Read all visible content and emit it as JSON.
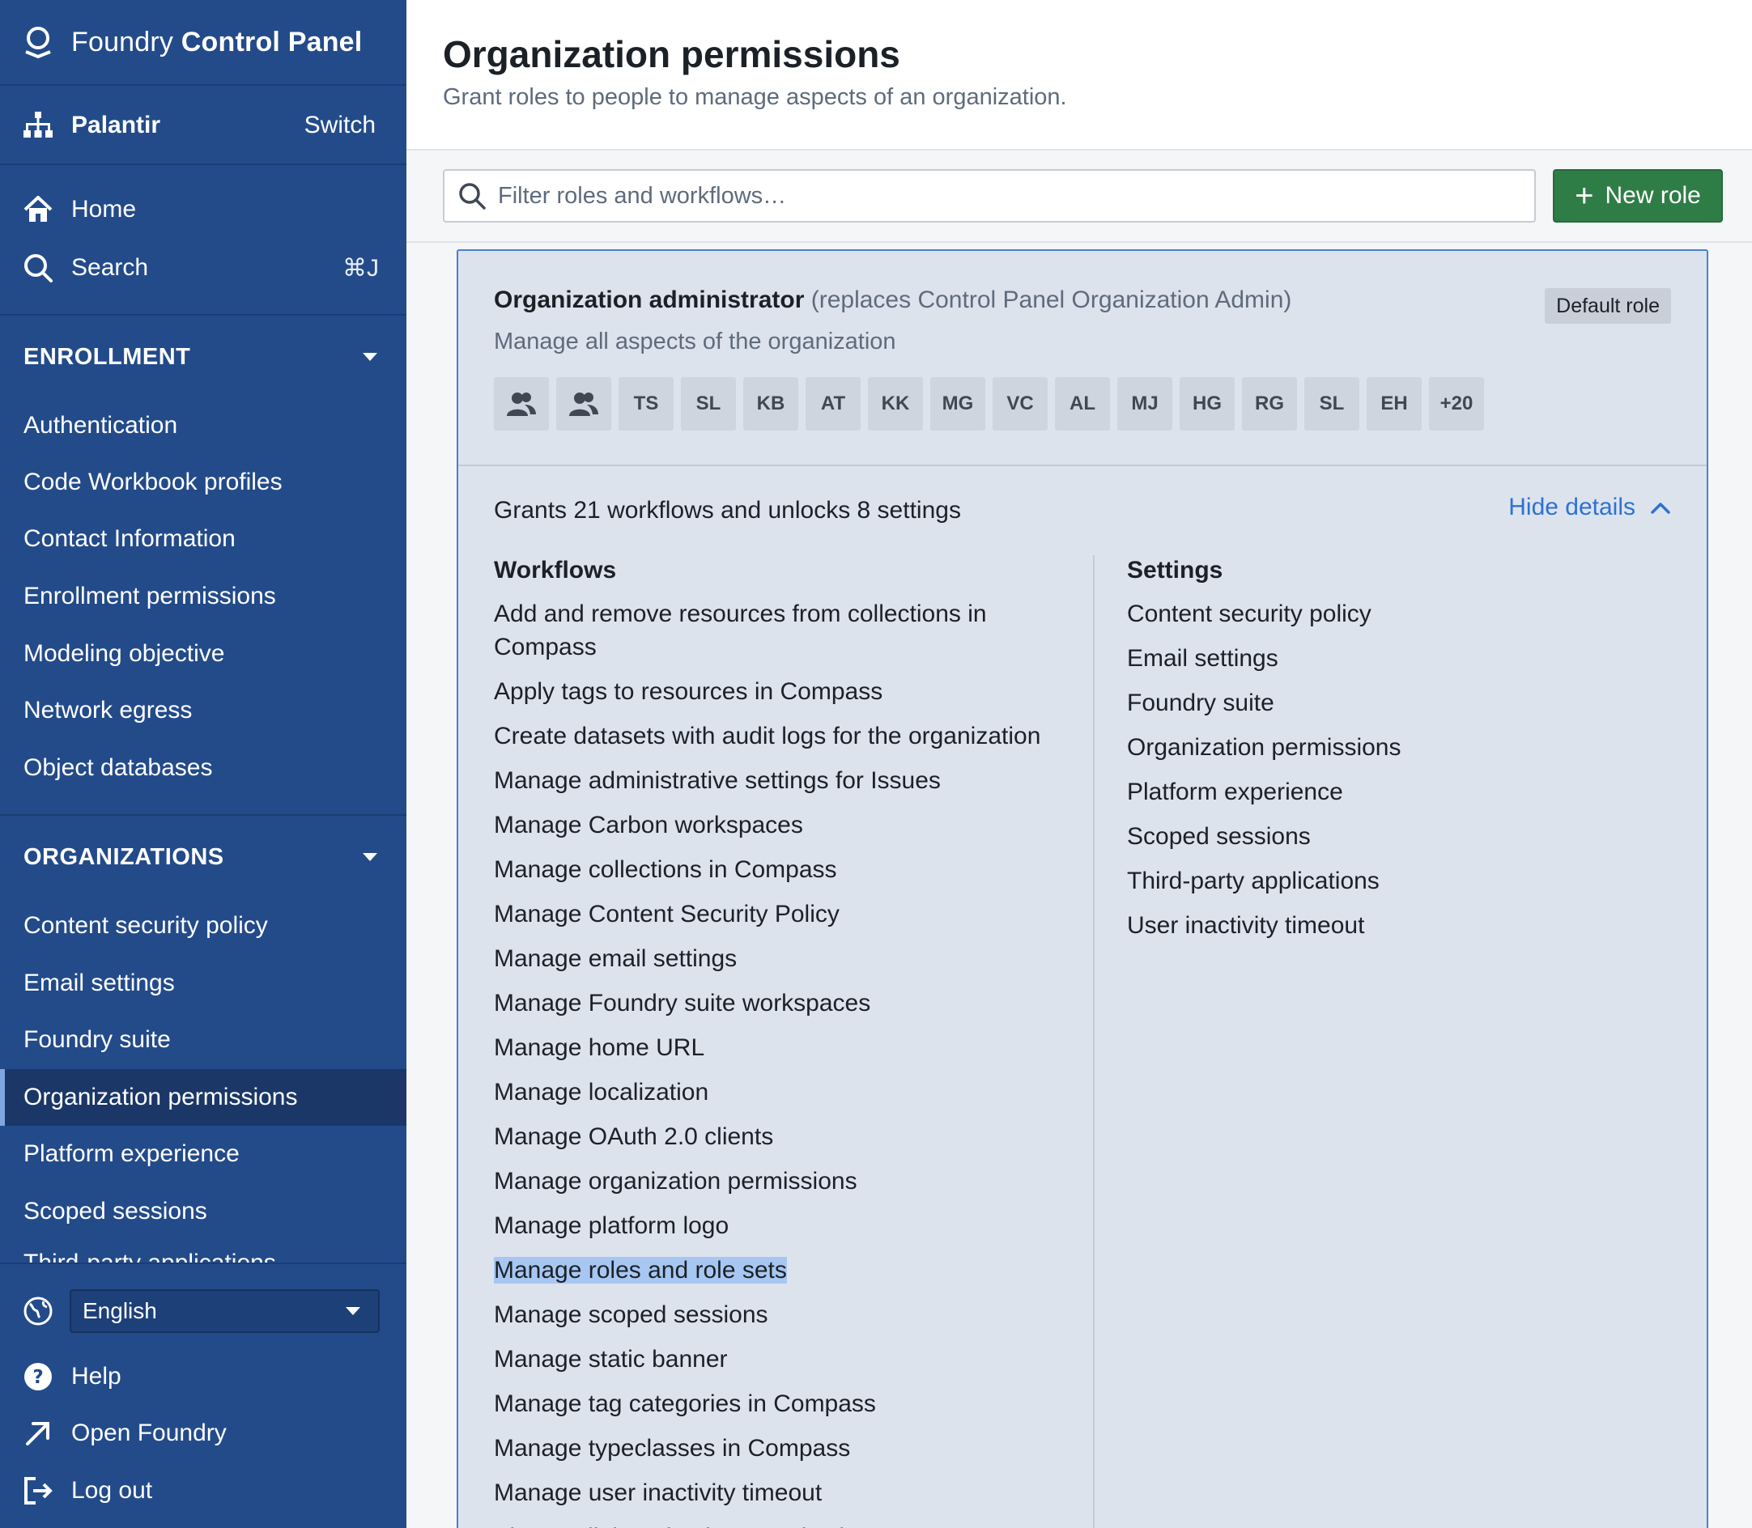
{
  "app": {
    "brand_light": "Foundry",
    "brand_bold": "Control Panel",
    "org_name": "Palantir",
    "switch_label": "Switch"
  },
  "nav": {
    "home": "Home",
    "search": "Search",
    "search_shortcut": "⌘J"
  },
  "enrollment": {
    "heading": "ENROLLMENT",
    "items": [
      "Authentication",
      "Code Workbook profiles",
      "Contact Information",
      "Enrollment permissions",
      "Modeling objective",
      "Network egress",
      "Object databases"
    ]
  },
  "organizations": {
    "heading": "ORGANIZATIONS",
    "items": [
      "Content security policy",
      "Email settings",
      "Foundry suite",
      "Organization permissions",
      "Platform experience",
      "Scoped sessions",
      "Third-party applications"
    ],
    "active_index": 3
  },
  "footer": {
    "language": "English",
    "help": "Help",
    "open_foundry": "Open Foundry",
    "logout": "Log out"
  },
  "page": {
    "title": "Organization permissions",
    "subtitle": "Grant roles to people to manage aspects of an organization."
  },
  "toolbar": {
    "filter_placeholder": "Filter roles and workflows…",
    "new_role_label": "New role"
  },
  "role": {
    "name": "Organization administrator",
    "replaces": "(replaces Control Panel Organization Admin)",
    "badge": "Default role",
    "description": "Manage all aspects of the organization",
    "members": [
      "TS",
      "SL",
      "KB",
      "AT",
      "KK",
      "MG",
      "VC",
      "AL",
      "MJ",
      "HG",
      "RG",
      "SL",
      "EH",
      "+20"
    ],
    "grants_summary": "Grants 21 workflows and unlocks 8 settings",
    "hide_details": "Hide details",
    "workflows_heading": "Workflows",
    "settings_heading": "Settings",
    "workflows": [
      "Add and remove resources from collections in Compass",
      "Apply tags to resources in Compass",
      "Create datasets with audit logs for the organization",
      "Manage administrative settings for Issues",
      "Manage Carbon workspaces",
      "Manage collections in Compass",
      "Manage Content Security Policy",
      "Manage email settings",
      "Manage Foundry suite workspaces",
      "Manage home URL",
      "Manage localization",
      "Manage OAuth 2.0 clients",
      "Manage organization permissions",
      "Manage platform logo",
      "Manage roles and role sets",
      "Manage scoped sessions",
      "Manage static banner",
      "Manage tag categories in Compass",
      "Manage typeclasses in Compass",
      "Manage user inactivity timeout",
      "View audit logs for the organization"
    ],
    "selected_workflow_index": 14,
    "settings": [
      "Content security policy",
      "Email settings",
      "Foundry suite",
      "Organization permissions",
      "Platform experience",
      "Scoped sessions",
      "Third-party applications",
      "User inactivity timeout"
    ]
  },
  "colors": {
    "sidebar": "#234b8a",
    "accent_button": "#2f7d46",
    "link": "#2d72d2",
    "selection": "#a7c7f2"
  }
}
